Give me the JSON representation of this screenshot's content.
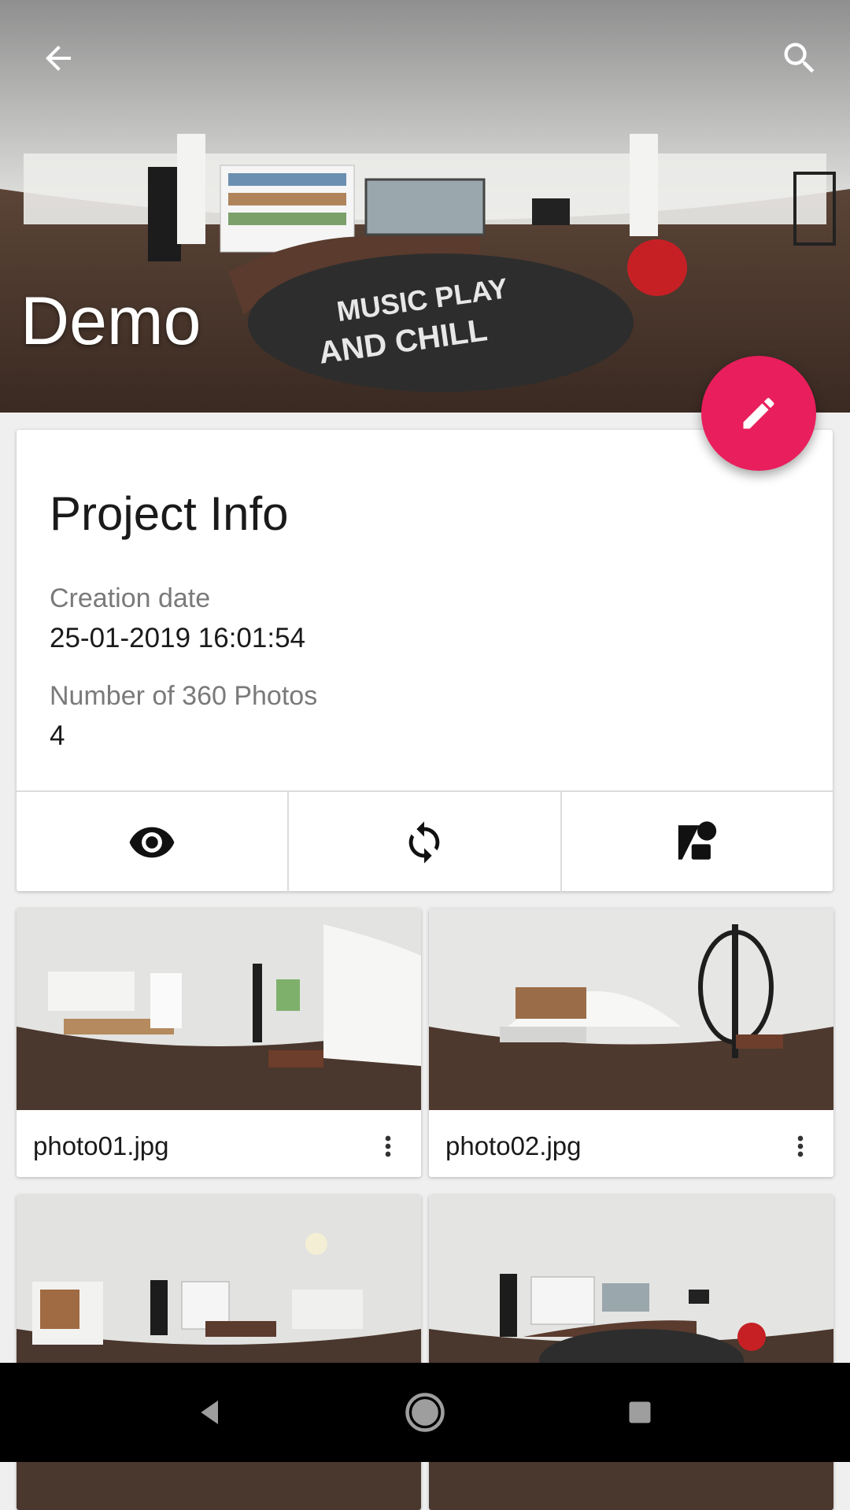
{
  "header": {
    "title": "Demo",
    "icons": {
      "back": "arrow-back-icon",
      "search": "search-icon",
      "fab": "edit-pencil-icon"
    },
    "fab_color": "#e91e5c"
  },
  "project_info": {
    "title": "Project Info",
    "creation_label": "Creation date",
    "creation_value": "25-01-2019 16:01:54",
    "photos_label": "Number of 360 Photos",
    "photos_value": "4",
    "actions": [
      "eye-icon",
      "sync-icon",
      "shapes-icon"
    ]
  },
  "photos": [
    {
      "name": "photo01.jpg"
    },
    {
      "name": "photo02.jpg"
    },
    {
      "name": ""
    },
    {
      "name": ""
    }
  ],
  "navbar": {
    "icons": [
      "back-triangle-icon",
      "home-circle-icon",
      "recents-square-icon"
    ]
  }
}
